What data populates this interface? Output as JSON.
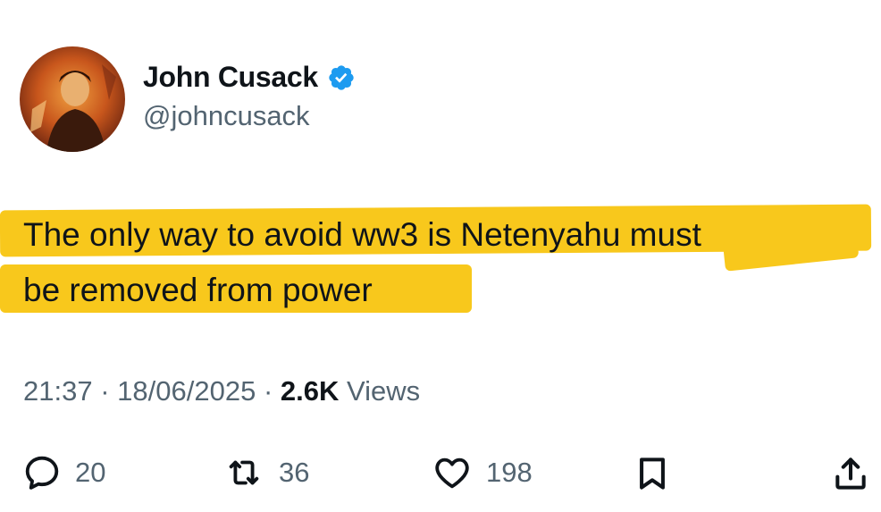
{
  "author": {
    "name": "John Cusack",
    "handle": "@johncusack",
    "verified_color": "#1d9bf0"
  },
  "tweet": {
    "line1": "The only way to avoid ww3 is Netenyahu must",
    "line2": "be removed from power",
    "highlight_color": "#f8c81c"
  },
  "meta": {
    "time": "21:37",
    "date": "18/06/2025",
    "views_count": "2.6K",
    "views_label": "Views",
    "separator": "·"
  },
  "actions": {
    "replies": "20",
    "reposts": "36",
    "likes": "198"
  },
  "icons": [
    "reply-icon",
    "repost-icon",
    "like-icon",
    "bookmark-icon",
    "share-icon",
    "verified-badge-icon"
  ]
}
